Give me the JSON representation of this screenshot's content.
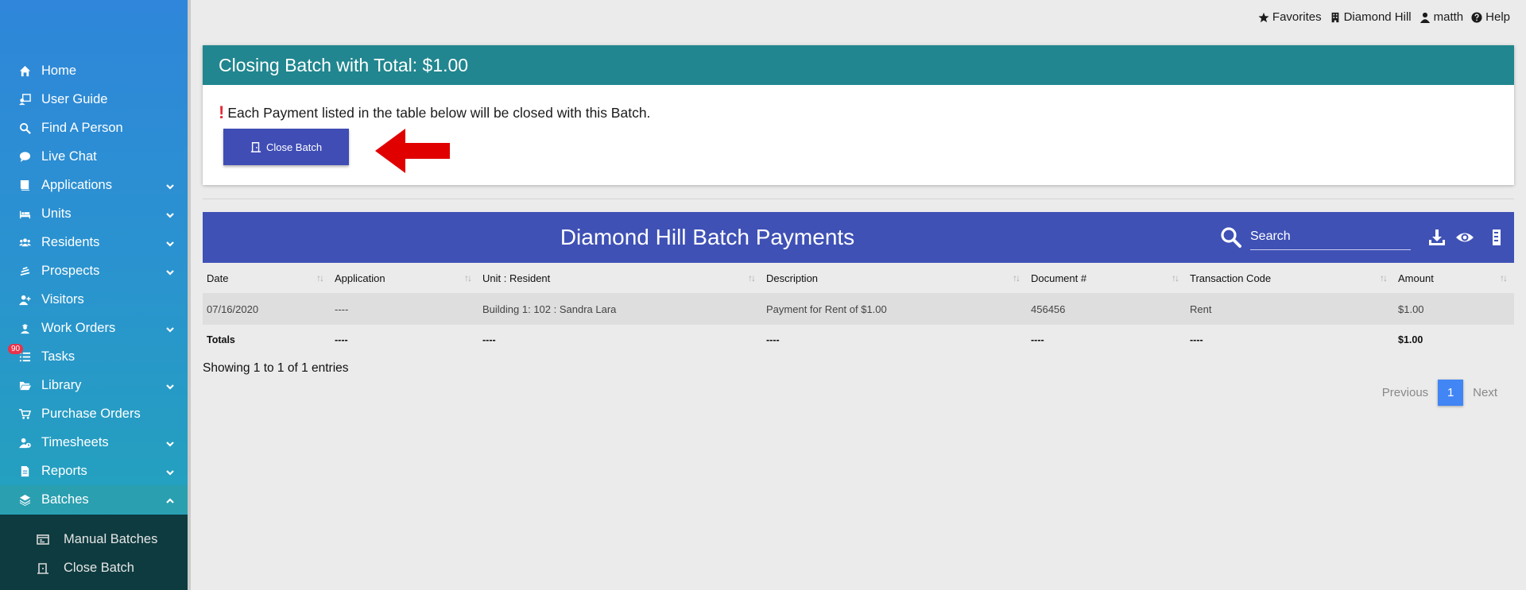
{
  "sidebar": {
    "items": [
      {
        "label": "Home",
        "icon": "home-icon"
      },
      {
        "label": "User Guide",
        "icon": "user-guide-icon"
      },
      {
        "label": "Find A Person",
        "icon": "search-icon"
      },
      {
        "label": "Live Chat",
        "icon": "chat-icon"
      },
      {
        "label": "Applications",
        "icon": "book-icon"
      },
      {
        "label": "Units",
        "icon": "bed-icon"
      },
      {
        "label": "Residents",
        "icon": "users-icon"
      },
      {
        "label": "Prospects",
        "icon": "prospects-icon"
      },
      {
        "label": "Visitors",
        "icon": "user-plus-icon"
      },
      {
        "label": "Work Orders",
        "icon": "worker-icon"
      },
      {
        "label": "Tasks",
        "icon": "list-icon",
        "badge": "90"
      },
      {
        "label": "Library",
        "icon": "folder-icon"
      },
      {
        "label": "Purchase Orders",
        "icon": "cart-icon"
      },
      {
        "label": "Timesheets",
        "icon": "user-clock-icon"
      },
      {
        "label": "Reports",
        "icon": "file-icon"
      },
      {
        "label": "Batches",
        "icon": "layers-icon"
      }
    ],
    "submenu": [
      {
        "label": "Manual Batches",
        "icon": "batch-list-icon"
      },
      {
        "label": "Close Batch",
        "icon": "close-batch-icon"
      }
    ]
  },
  "topbar": {
    "favorites": "Favorites",
    "property": "Diamond Hill",
    "user": "matth",
    "help": "Help"
  },
  "closing": {
    "title": "Closing Batch with Total: $1.00",
    "notice": "Each Payment listed in the table below will be closed with this Batch.",
    "button_label": "Close Batch"
  },
  "table": {
    "title": "Diamond Hill Batch Payments",
    "search_placeholder": "Search",
    "columns": [
      "Date",
      "Application",
      "Unit : Resident",
      "Description",
      "Document #",
      "Transaction Code",
      "Amount"
    ],
    "rows": [
      [
        "07/16/2020",
        "----",
        "Building 1: 102 : Sandra Lara",
        "Payment for Rent of $1.00",
        "456456",
        "Rent",
        "$1.00"
      ]
    ],
    "totals": [
      "Totals",
      "----",
      "----",
      "----",
      "----",
      "----",
      "$1.00"
    ],
    "showing": "Showing 1 to 1 of 1 entries",
    "pager": {
      "previous": "Previous",
      "current": "1",
      "next": "Next"
    }
  },
  "colors": {
    "sidebar_top": "#2f86da",
    "card_header": "#21868f",
    "table_header": "#3f51b5",
    "button": "#3f4db5",
    "arrow": "#e00000",
    "pager_active": "#4285f4"
  }
}
